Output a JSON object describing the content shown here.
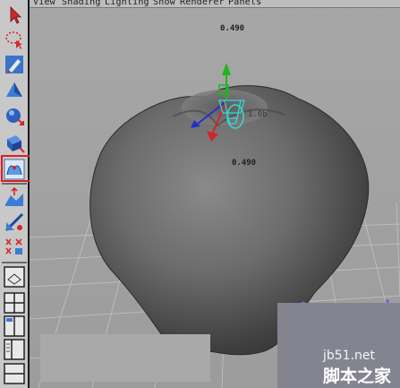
{
  "menubar": {
    "items": [
      "View",
      "Shading",
      "Lighting",
      "Show",
      "Renderer",
      "Panels"
    ]
  },
  "viewport": {
    "readout_top": "0.490",
    "readout_side": "1.0b",
    "readout_mid": "0.490"
  },
  "watermark": {
    "domain": "jb51.net",
    "site": "脚本之家"
  },
  "colors": {
    "highlight": "#e21c22",
    "manipulator_y": "#1fb61f",
    "manipulator_x": "#d8212a",
    "manipulator_z": "#2431c9",
    "selection": "#37d8d0"
  },
  "toolbar": {
    "tools": [
      "select-arrow-icon",
      "lasso-select-icon",
      "paint-select-icon",
      "move-icon",
      "rotate-icon",
      "scale-icon",
      "sculpt-icon",
      "soft-mod-icon",
      "show-manipulator-icon",
      "last-tool-icon",
      "single-perspective-layout-icon",
      "four-view-layout-icon",
      "two-view-layout-icon",
      "outliner-layout-icon"
    ]
  }
}
